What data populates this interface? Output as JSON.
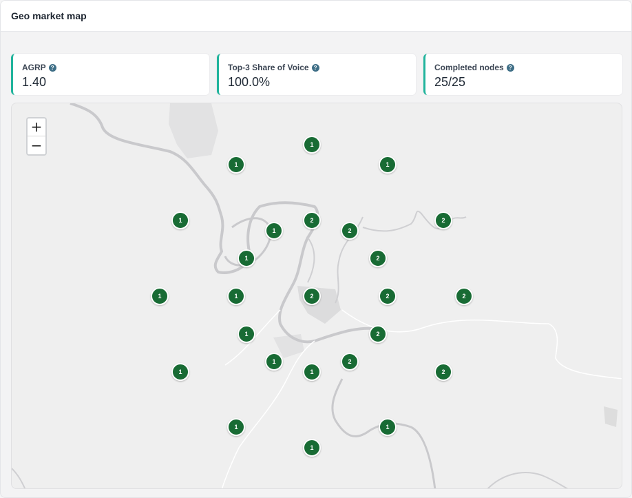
{
  "panel": {
    "title": "Geo market map"
  },
  "kpis": [
    {
      "label": "AGRP",
      "value": "1.40"
    },
    {
      "label": "Top-3 Share of Voice",
      "value": "100.0%"
    },
    {
      "label": "Completed nodes",
      "value": "25/25"
    }
  ],
  "colors": {
    "accent": "#20b49c",
    "marker": "#186b34",
    "help_icon": "#3f6f87"
  },
  "map": {
    "zoom_in_label": "+",
    "zoom_out_label": "−",
    "markers": [
      "1",
      "1",
      "1",
      "1",
      "2",
      "2",
      "1",
      "2",
      "1",
      "2",
      "1",
      "1",
      "2",
      "2",
      "2",
      "1",
      "2",
      "1",
      "2",
      "1",
      "2",
      "1",
      "1",
      "1"
    ]
  }
}
